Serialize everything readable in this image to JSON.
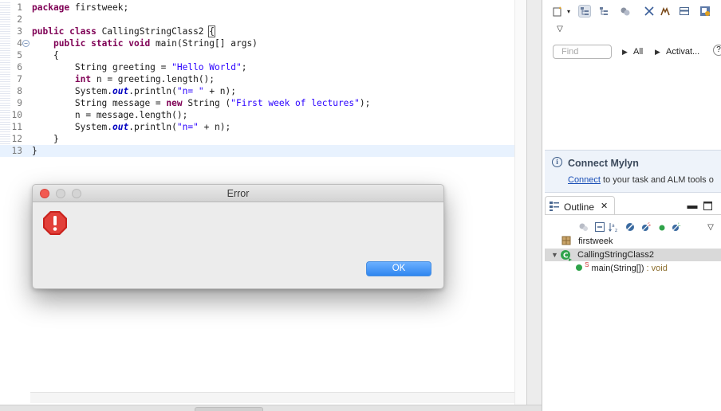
{
  "editor": {
    "lines": [
      {
        "n": "1",
        "html": "<span class=\"kw\">package</span> firstweek;"
      },
      {
        "n": "2",
        "html": ""
      },
      {
        "n": "3",
        "html": "<span class=\"kw\">public class</span> CallingStringClass2 <span class=\"brk\">{</span>"
      },
      {
        "n": "4",
        "html": "    <span class=\"kw\">public static void</span> main(String[] args)",
        "fold": "⊖"
      },
      {
        "n": "5",
        "html": "    {"
      },
      {
        "n": "6",
        "html": "        String greeting = <span class=\"str\">\"Hello World\"</span>;"
      },
      {
        "n": "7",
        "html": "        <span class=\"kw\">int</span> n = greeting.length();"
      },
      {
        "n": "8",
        "html": "        System.<span class=\"fld\">out</span>.println(<span class=\"str\">\"n= \"</span> + n);"
      },
      {
        "n": "9",
        "html": "        String message = <span class=\"kw\">new</span> String (<span class=\"str\">\"First week of lectures\"</span>);"
      },
      {
        "n": "10",
        "html": "        n = message.length();"
      },
      {
        "n": "11",
        "html": "        System.<span class=\"fld\">out</span>.println(<span class=\"str\">\"n=\"</span> + n);"
      },
      {
        "n": "12",
        "html": "    }"
      },
      {
        "n": "13",
        "html": "}",
        "current": true
      }
    ]
  },
  "task_panel": {
    "find_placeholder": "Find",
    "all_label": "All",
    "activate_label": "Activat...",
    "help_label": "?"
  },
  "mylyn": {
    "title": "Connect Mylyn",
    "link": "Connect",
    "desc": " to your task and ALM tools o"
  },
  "outline": {
    "tab_label": "Outline",
    "close": "✕",
    "package": "firstweek",
    "class_name": "CallingStringClass2",
    "method_name": "main(String[])",
    "method_type": " : void"
  },
  "dialog": {
    "title": "Error",
    "ok_label": "OK"
  },
  "colors": {
    "accent": "#2f86f0",
    "error": "#d9302c"
  }
}
